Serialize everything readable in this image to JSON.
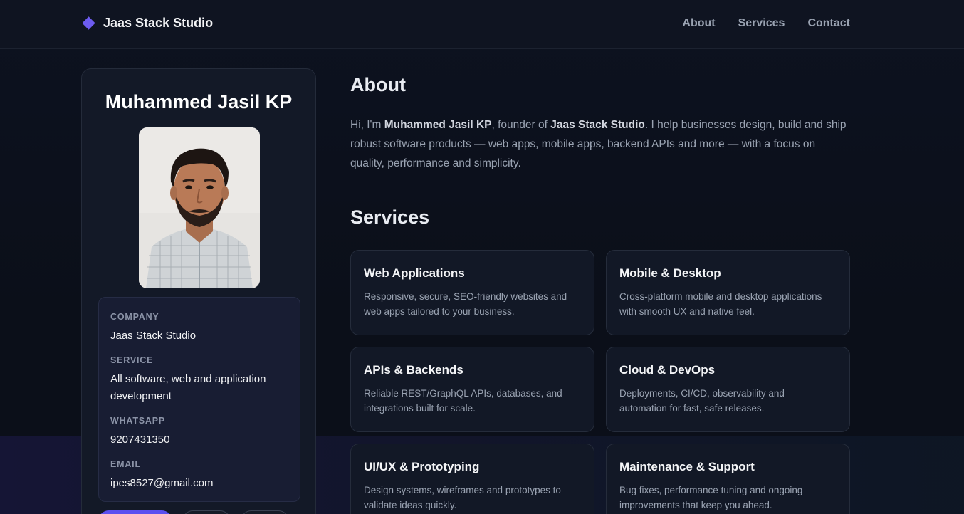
{
  "header": {
    "brand": "Jaas Stack Studio",
    "nav": [
      "About",
      "Services",
      "Contact"
    ]
  },
  "profile": {
    "name": "Muhammed Jasil KP",
    "fields": [
      {
        "label": "COMPANY",
        "value": "Jaas Stack Studio"
      },
      {
        "label": "SERVICE",
        "value": "All software, web and application development"
      },
      {
        "label": "WHATSAPP",
        "value": "9207431350"
      },
      {
        "label": "EMAIL",
        "value": "ipes8527@gmail.com"
      }
    ]
  },
  "about": {
    "title": "About",
    "intro": "Hi, I'm ",
    "name": "Muhammed Jasil KP",
    "mid": ", founder of ",
    "company": "Jaas Stack Studio",
    "rest": ". I help businesses design, build and ship robust software products — web apps, mobile apps, backend APIs and more — with a focus on quality, performance and simplicity."
  },
  "services": {
    "title": "Services",
    "items": [
      {
        "title": "Web Applications",
        "desc": "Responsive, secure, SEO-friendly websites and web apps tailored to your business."
      },
      {
        "title": "Mobile & Desktop",
        "desc": "Cross-platform mobile and desktop applications with smooth UX and native feel."
      },
      {
        "title": "APIs & Backends",
        "desc": "Reliable REST/GraphQL APIs, databases, and integrations built for scale."
      },
      {
        "title": "Cloud & DevOps",
        "desc": "Deployments, CI/CD, observability and automation for fast, safe releases."
      },
      {
        "title": "UI/UX & Prototyping",
        "desc": "Design systems, wireframes and prototypes to validate ideas quickly."
      },
      {
        "title": "Maintenance & Support",
        "desc": "Bug fixes, performance tuning and ongoing improvements that keep you ahead."
      }
    ]
  },
  "colors": {
    "accent": "#5b4ff0",
    "background": "#0b0f19"
  }
}
